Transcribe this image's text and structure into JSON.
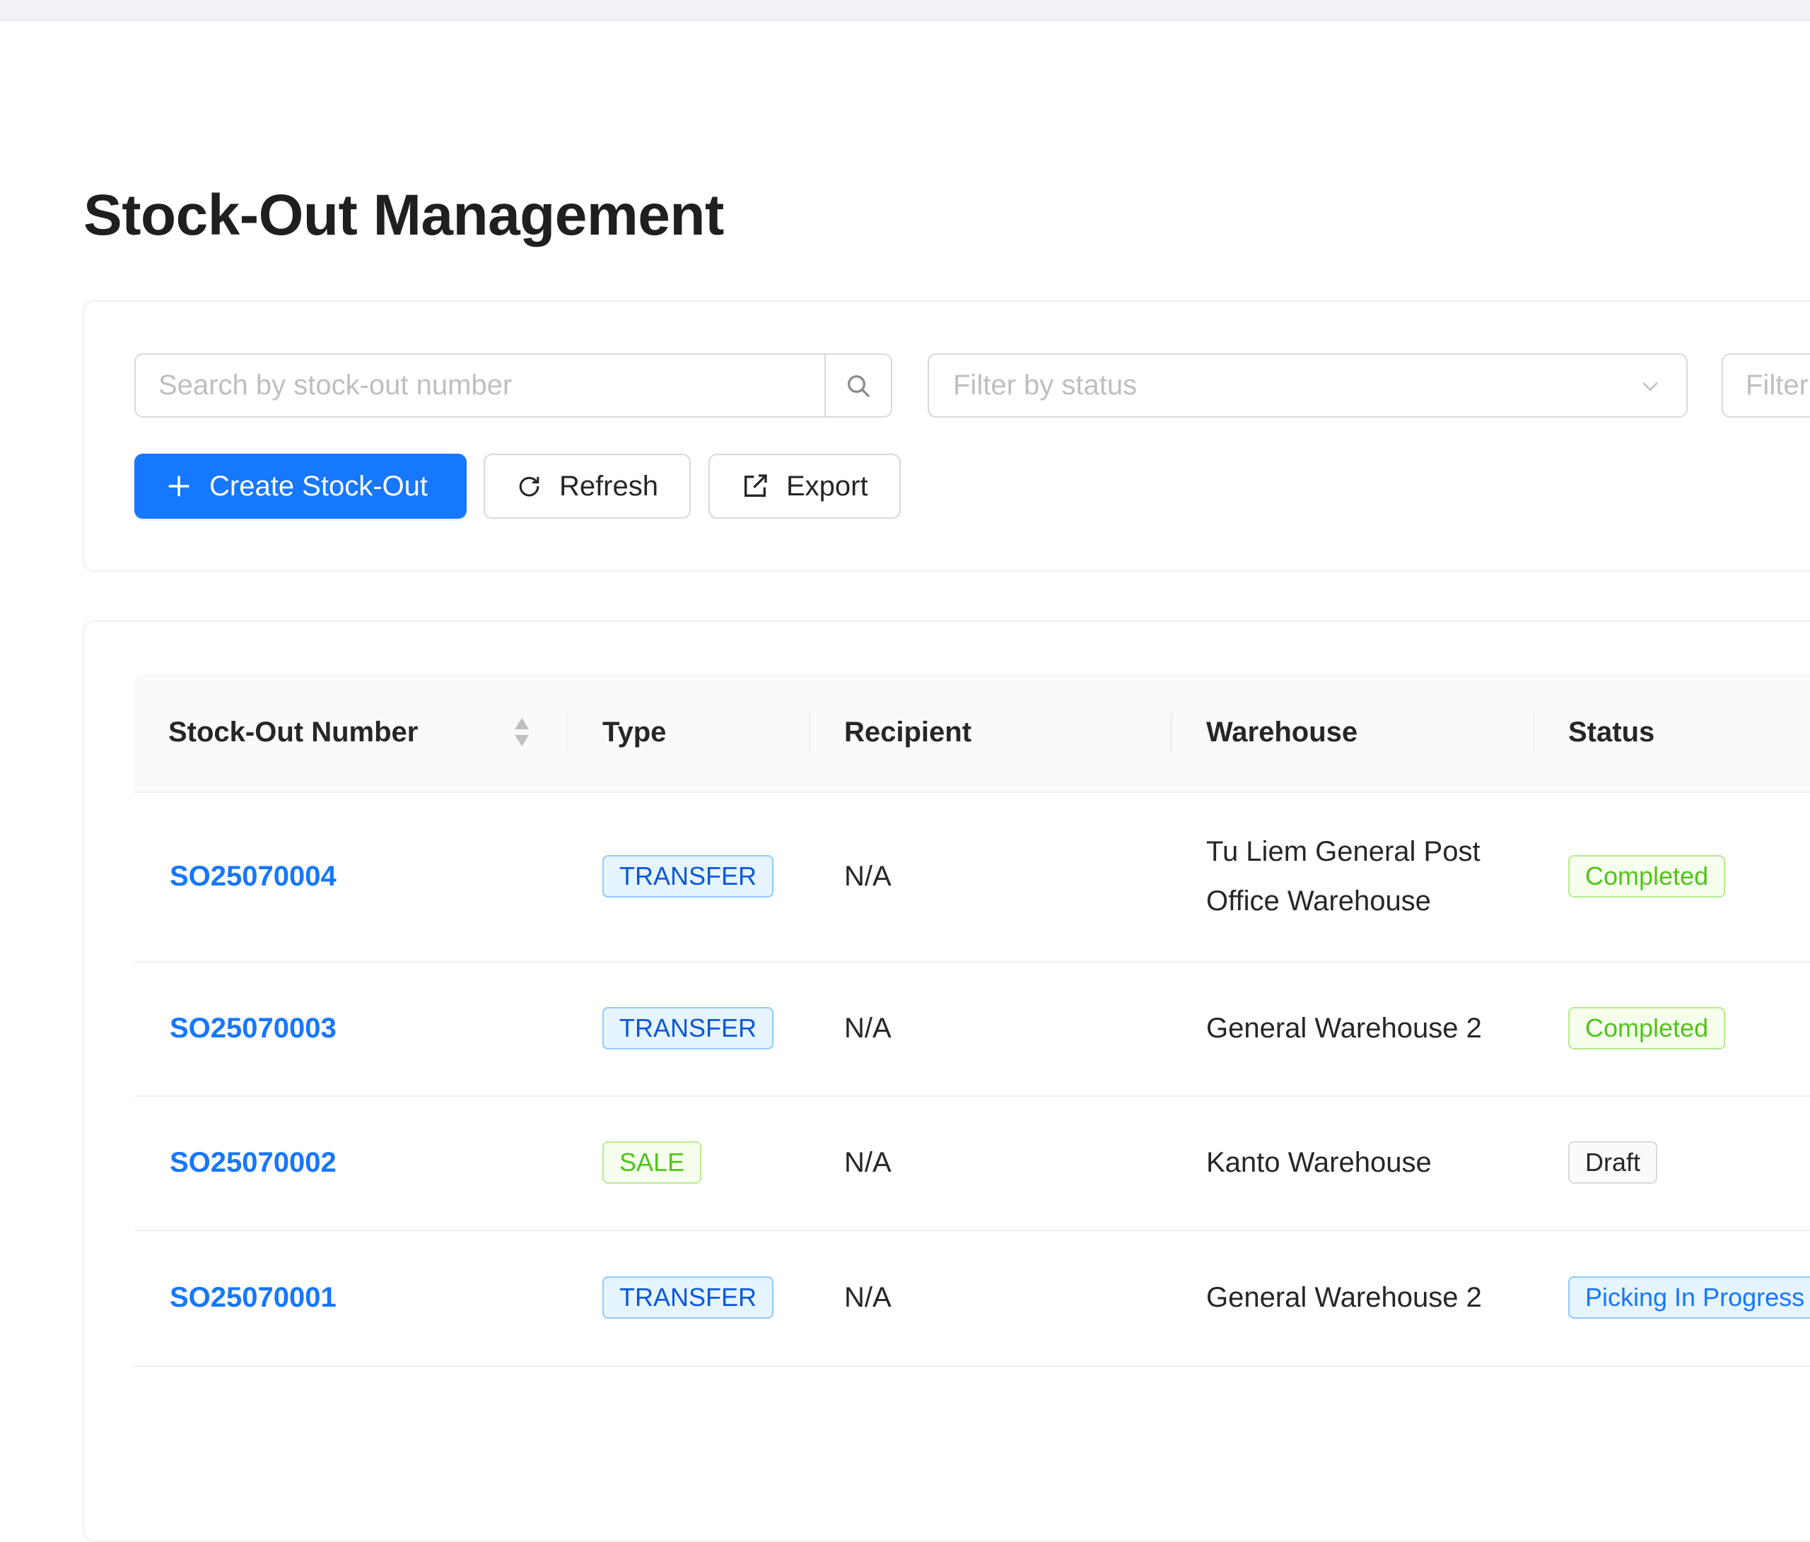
{
  "page": {
    "title": "Stock-Out Management"
  },
  "toolbar": {
    "search_placeholder": "Search by stock-out number",
    "status_filter_placeholder": "Filter by status",
    "second_filter_placeholder": "Filter",
    "create_label": "Create Stock-Out",
    "refresh_label": "Refresh",
    "export_label": "Export",
    "primary_color": "#1677ff"
  },
  "table": {
    "columns": [
      "Stock-Out Number",
      "Type",
      "Recipient",
      "Warehouse",
      "Status"
    ],
    "rows": [
      {
        "number": "SO25070004",
        "type": "TRANSFER",
        "type_color": "blue",
        "recipient": "N/A",
        "warehouse": "Tu Liem General Post Office Warehouse",
        "status": "Completed",
        "status_color": "green"
      },
      {
        "number": "SO25070003",
        "type": "TRANSFER",
        "type_color": "blue",
        "recipient": "N/A",
        "warehouse": "General Warehouse 2",
        "status": "Completed",
        "status_color": "green"
      },
      {
        "number": "SO25070002",
        "type": "SALE",
        "type_color": "green",
        "recipient": "N/A",
        "warehouse": "Kanto Warehouse",
        "status": "Draft",
        "status_color": "default"
      },
      {
        "number": "SO25070001",
        "type": "TRANSFER",
        "type_color": "blue",
        "recipient": "N/A",
        "warehouse": "General Warehouse 2",
        "status": "Picking In Progress",
        "status_color": "processing"
      }
    ]
  }
}
